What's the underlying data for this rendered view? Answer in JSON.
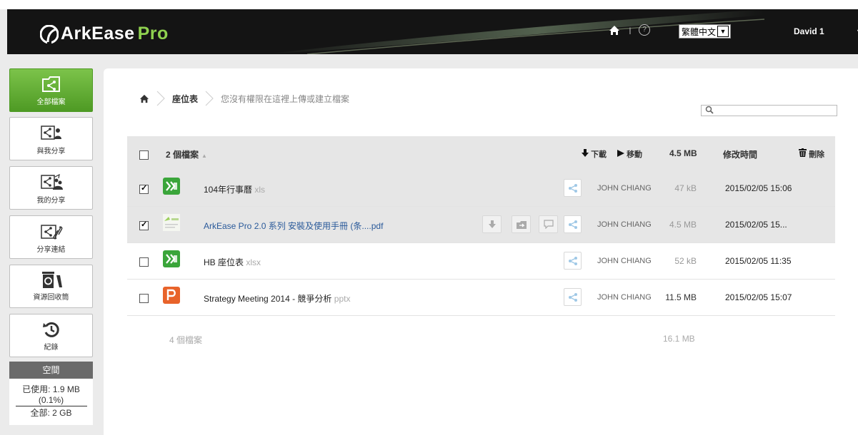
{
  "header": {
    "logo_main": "ArkEase",
    "logo_pro": "Pro",
    "separator": "I",
    "help": "?",
    "language": "繁體中文",
    "user": "David 1"
  },
  "sidebar": {
    "items": [
      {
        "label": "全部檔案",
        "icon": "all-files-icon"
      },
      {
        "label": "與我分享",
        "icon": "shared-with-me-icon"
      },
      {
        "label": "我的分享",
        "icon": "my-shares-icon"
      },
      {
        "label": "分享連結",
        "icon": "share-link-icon"
      },
      {
        "label": "資源回收筒",
        "icon": "recycle-bin-icon"
      },
      {
        "label": "紀錄",
        "icon": "history-icon"
      }
    ],
    "space": {
      "title": "空間",
      "used": "已使用: 1.9 MB",
      "percent": "(0.1%)",
      "total": "全部: 2 GB"
    }
  },
  "breadcrumb": {
    "current": "座位表",
    "note": "您沒有權限在這裡上傳或建立檔案"
  },
  "table": {
    "header": {
      "count": "2 個檔案",
      "download": "下載",
      "move": "移動",
      "size": "4.5 MB",
      "modified": "修改時間",
      "delete": "刪除"
    },
    "rows": [
      {
        "name": "104年行事曆",
        "ext": "xls",
        "owner": "JOHN CHIANG",
        "size": "47 kB",
        "time": "2015/02/05 15:06",
        "checked": true,
        "type": "excel"
      },
      {
        "name": "ArkEase Pro 2.0 系列 安裝及使用手冊 (条....",
        "ext": "pdf",
        "owner": "JOHN CHIANG",
        "size": "4.5 MB",
        "time": "2015/02/05 15...",
        "checked": true,
        "type": "pdf"
      },
      {
        "name": "HB 座位表",
        "ext": "xlsx",
        "owner": "JOHN CHIANG",
        "size": "52 kB",
        "time": "2015/02/05 11:35",
        "checked": false,
        "type": "excel"
      },
      {
        "name": "Strategy Meeting 2014 - 競爭分析",
        "ext": "pptx",
        "owner": "JOHN CHIANG",
        "size": "11.5 MB",
        "time": "2015/02/05 15:07",
        "checked": false,
        "type": "powerpoint"
      }
    ],
    "footer": {
      "count": "4 個檔案",
      "size": "16.1 MB"
    }
  },
  "colors": {
    "brand_green": "#6ab43c",
    "header_bg": "#141414",
    "excel_green": "#3aa53a",
    "ppt_orange": "#e8632a"
  }
}
